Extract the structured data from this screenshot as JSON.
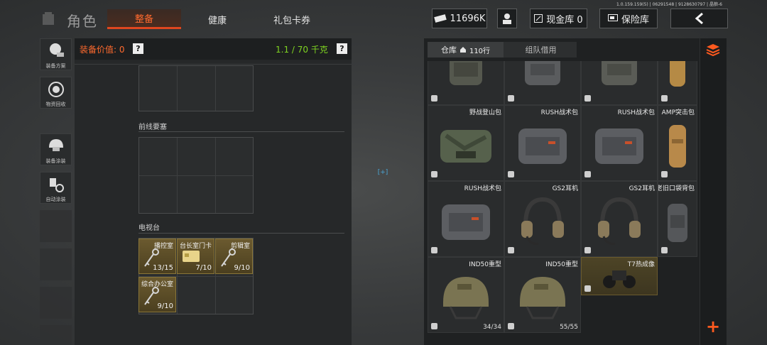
{
  "version": "1.0.159.159(5) | 06291548 | 9128630797 | 晶狼-6",
  "header": {
    "title": "角色",
    "tabs": [
      {
        "label": "整备",
        "active": true
      },
      {
        "label": "健康",
        "active": false
      },
      {
        "label": "礼包卡券",
        "active": false
      }
    ],
    "currency": "11696K",
    "cash_vault": "现金库 0",
    "safe_vault": "保险库"
  },
  "sidebar": {
    "items": [
      {
        "label": "装备方案"
      },
      {
        "label": "物资回收"
      },
      {
        "label": "装备涂装"
      },
      {
        "label": "自动涂装"
      }
    ]
  },
  "equipment": {
    "value_label": "装备价值: 0",
    "weight_label": "1.1 / 70 千克",
    "help": "?",
    "sections": [
      {
        "label": "前线要塞"
      },
      {
        "label": "电视台"
      }
    ],
    "keys": [
      {
        "name": "播控室",
        "count": "13/15"
      },
      {
        "name": "台长室门卡",
        "count": "7/10"
      },
      {
        "name": "剪辑室",
        "count": "9/10"
      },
      {
        "name": "综合办公室",
        "count": "9/10"
      }
    ],
    "center_mark": "[+]"
  },
  "stash": {
    "tabs": [
      {
        "label": "仓库",
        "extra": "110行",
        "active": true
      },
      {
        "label": "组队借用",
        "active": false
      }
    ],
    "rows": [
      [
        {
          "name": "",
          "count": ""
        },
        {
          "name": "",
          "count": ""
        },
        {
          "name": "",
          "count": ""
        },
        {
          "name": "",
          "count": ""
        }
      ],
      [
        {
          "name": "野战登山包",
          "count": ""
        },
        {
          "name": "RUSH战术包",
          "count": ""
        },
        {
          "name": "RUSH战术包",
          "count": ""
        },
        {
          "name": "AMP突击包",
          "count": ""
        }
      ],
      [
        {
          "name": "RUSH战术包",
          "count": ""
        },
        {
          "name": "GS2耳机",
          "count": ""
        },
        {
          "name": "GS2耳机",
          "count": ""
        },
        {
          "name": "老旧口袋背包",
          "count": ""
        }
      ],
      [
        {
          "name": "IND50重型",
          "count": "34/34"
        },
        {
          "name": "IND50重型",
          "count": "55/55"
        },
        {
          "name": "T7热成像",
          "count": ""
        }
      ]
    ]
  },
  "colors": {
    "accent": "#ff6a2e",
    "weight_ok": "#7ed321",
    "key_bg": "#6b5a2f"
  }
}
